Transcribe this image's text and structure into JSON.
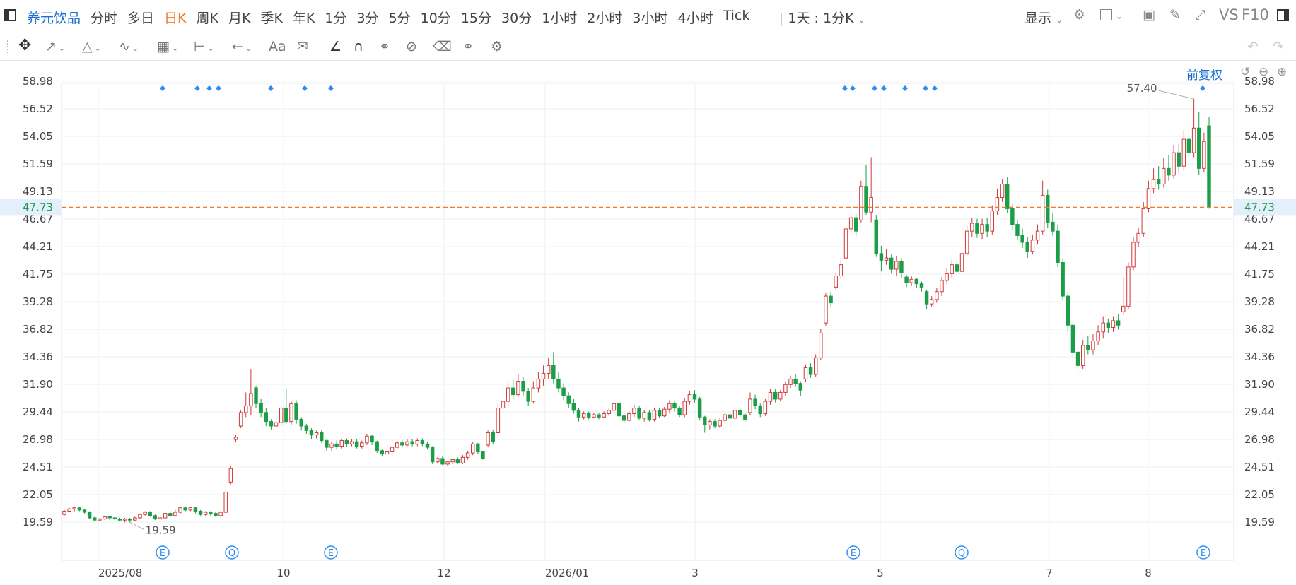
{
  "header": {
    "stock_name": "养元饮品",
    "period_tabs": [
      "分时",
      "多日",
      "日K",
      "周K",
      "月K",
      "季K",
      "年K",
      "1分",
      "3分",
      "5分",
      "10分",
      "15分",
      "30分",
      "1小时",
      "2小时",
      "3小时",
      "4小时",
      "Tick"
    ],
    "active_tab": "日K",
    "interval_select": "1天 : 1分K",
    "display_menu": "显示",
    "vs_label": "VS",
    "f10_label": "F10"
  },
  "toolbar": {
    "tools": [
      "move-icon",
      "line-icon",
      "polyline-icon",
      "wave-icon",
      "fib-icon",
      "measure-icon",
      "arrow-icon",
      "text-tool",
      "comment-icon",
      "angle-icon",
      "magnet-icon",
      "lock-icon",
      "hide-icon",
      "delete-icon",
      "link-icon",
      "settings-icon"
    ],
    "text_tool_label": "Aa"
  },
  "chart_controls": {
    "adjust_label": "前复权"
  },
  "colors": {
    "up": "#d0393b",
    "down": "#1a9e47",
    "marker": "#2d8cf0",
    "price_line": "#f0792b",
    "axis_text": "#444",
    "grid": "#eef0f2"
  },
  "chart_data": {
    "type": "candlestick",
    "y_ticks": [
      "58.98",
      "56.52",
      "54.05",
      "51.59",
      "49.13",
      "46.67",
      "44.21",
      "41.75",
      "39.28",
      "36.82",
      "34.36",
      "31.90",
      "29.44",
      "26.98",
      "24.51",
      "22.05",
      "19.59"
    ],
    "ylim": [
      18.4,
      60.2
    ],
    "x_ticks": [
      "2025/08",
      "10",
      "12",
      "2026/01",
      "3",
      "5",
      "7",
      "8"
    ],
    "current_price": "47.73",
    "current_price_value": 47.73,
    "high_label": "57.40",
    "low_label": "19.59",
    "high_value": 57.4,
    "low_value": 19.59,
    "event_markers": [
      "E",
      "Q",
      "E",
      "E",
      "Q",
      "E"
    ],
    "candles": [
      [
        20.3,
        20.6,
        20.2,
        20.7
      ],
      [
        20.6,
        20.8,
        20.5,
        20.9
      ],
      [
        20.8,
        20.9,
        20.6,
        21.0
      ],
      [
        20.9,
        20.7,
        20.6,
        21.0
      ],
      [
        20.7,
        20.5,
        20.4,
        20.8
      ],
      [
        20.5,
        20.0,
        19.9,
        20.6
      ],
      [
        20.0,
        19.8,
        19.7,
        20.1
      ],
      [
        19.8,
        19.9,
        19.7,
        20.0
      ],
      [
        19.9,
        20.1,
        19.8,
        20.2
      ],
      [
        20.1,
        20.0,
        19.8,
        20.2
      ],
      [
        20.0,
        19.9,
        19.8,
        20.1
      ],
      [
        19.9,
        19.8,
        19.7,
        20.0
      ],
      [
        19.8,
        19.9,
        19.6,
        20.0
      ],
      [
        19.9,
        19.8,
        19.59,
        20.0
      ],
      [
        19.8,
        20.0,
        19.7,
        20.1
      ],
      [
        20.0,
        20.3,
        19.9,
        20.4
      ],
      [
        20.3,
        20.5,
        20.2,
        20.6
      ],
      [
        20.5,
        20.2,
        20.1,
        20.6
      ],
      [
        20.2,
        19.9,
        19.8,
        20.3
      ],
      [
        19.9,
        20.0,
        19.8,
        20.1
      ],
      [
        20.0,
        20.4,
        19.9,
        20.5
      ],
      [
        20.4,
        20.2,
        20.1,
        20.6
      ],
      [
        20.2,
        20.5,
        20.1,
        20.7
      ],
      [
        20.5,
        20.9,
        20.4,
        21.0
      ],
      [
        20.9,
        20.7,
        20.6,
        21.0
      ],
      [
        20.7,
        20.9,
        20.6,
        21.0
      ],
      [
        20.9,
        20.6,
        20.4,
        21.0
      ],
      [
        20.6,
        20.3,
        20.2,
        20.7
      ],
      [
        20.3,
        20.5,
        20.2,
        20.6
      ],
      [
        20.5,
        20.4,
        20.2,
        20.6
      ],
      [
        20.4,
        20.2,
        20.1,
        20.5
      ],
      [
        20.2,
        20.5,
        20.1,
        20.6
      ],
      [
        20.5,
        22.3,
        20.4,
        22.4
      ],
      [
        23.2,
        24.4,
        23.0,
        24.6
      ],
      [
        27.0,
        27.2,
        26.8,
        27.4
      ],
      [
        28.2,
        29.4,
        28.0,
        29.6
      ],
      [
        29.4,
        30.0,
        29.0,
        31.2
      ],
      [
        30.0,
        31.1,
        29.2,
        33.3
      ],
      [
        31.6,
        30.2,
        29.8,
        31.8
      ],
      [
        30.2,
        29.4,
        29.0,
        30.6
      ],
      [
        29.4,
        28.6,
        28.2,
        29.8
      ],
      [
        28.6,
        28.2,
        27.9,
        28.8
      ],
      [
        28.2,
        28.5,
        28.0,
        29.2
      ],
      [
        28.5,
        29.8,
        28.2,
        30.0
      ],
      [
        29.8,
        28.6,
        28.4,
        31.5
      ],
      [
        28.6,
        30.2,
        28.3,
        30.4
      ],
      [
        30.2,
        28.8,
        28.4,
        30.5
      ],
      [
        28.8,
        28.2,
        27.8,
        29.0
      ],
      [
        28.2,
        27.8,
        27.5,
        28.4
      ],
      [
        27.8,
        27.4,
        27.0,
        28.0
      ],
      [
        27.4,
        27.6,
        27.1,
        27.8
      ],
      [
        27.6,
        26.9,
        26.7,
        27.8
      ],
      [
        26.9,
        26.3,
        26.0,
        27.0
      ],
      [
        26.3,
        26.6,
        26.0,
        26.8
      ],
      [
        26.6,
        26.4,
        26.1,
        26.9
      ],
      [
        26.4,
        26.9,
        26.2,
        27.0
      ],
      [
        26.9,
        26.6,
        26.3,
        27.1
      ],
      [
        26.6,
        26.8,
        26.4,
        27.0
      ],
      [
        26.8,
        26.4,
        26.2,
        27.0
      ],
      [
        26.4,
        26.7,
        26.2,
        26.9
      ],
      [
        26.7,
        27.3,
        26.5,
        27.5
      ],
      [
        27.3,
        26.8,
        26.5,
        27.4
      ],
      [
        26.8,
        26.0,
        25.8,
        26.9
      ],
      [
        26.0,
        25.7,
        25.5,
        26.1
      ],
      [
        25.7,
        25.9,
        25.6,
        26.1
      ],
      [
        25.9,
        26.3,
        25.7,
        26.4
      ],
      [
        26.3,
        26.7,
        26.1,
        26.9
      ],
      [
        26.7,
        26.5,
        26.3,
        26.9
      ],
      [
        26.5,
        26.8,
        26.4,
        27.0
      ],
      [
        26.8,
        26.6,
        26.4,
        27.0
      ],
      [
        26.6,
        26.9,
        26.4,
        27.1
      ],
      [
        26.9,
        26.6,
        26.4,
        27.1
      ],
      [
        26.6,
        26.3,
        26.1,
        26.8
      ],
      [
        26.3,
        25.0,
        24.8,
        26.4
      ],
      [
        25.0,
        25.3,
        24.9,
        25.4
      ],
      [
        25.3,
        24.8,
        24.7,
        25.5
      ],
      [
        24.8,
        25.0,
        24.6,
        25.1
      ],
      [
        25.0,
        25.2,
        24.8,
        25.3
      ],
      [
        25.2,
        24.9,
        24.8,
        25.4
      ],
      [
        24.9,
        25.4,
        24.8,
        25.6
      ],
      [
        25.4,
        25.8,
        25.2,
        26.0
      ],
      [
        25.8,
        26.6,
        25.6,
        26.8
      ],
      [
        26.6,
        25.9,
        25.7,
        26.7
      ],
      [
        25.9,
        25.3,
        25.2,
        26.0
      ],
      [
        26.5,
        27.6,
        26.3,
        27.8
      ],
      [
        27.6,
        26.8,
        26.6,
        27.9
      ],
      [
        27.6,
        29.8,
        27.3,
        30.2
      ],
      [
        29.8,
        30.4,
        29.4,
        30.8
      ],
      [
        30.4,
        31.6,
        30.0,
        32.1
      ],
      [
        31.6,
        31.0,
        30.6,
        32.4
      ],
      [
        31.0,
        32.2,
        30.8,
        32.8
      ],
      [
        32.2,
        31.3,
        30.9,
        32.6
      ],
      [
        31.3,
        30.4,
        30.0,
        31.6
      ],
      [
        30.4,
        31.6,
        30.2,
        32.2
      ],
      [
        31.6,
        32.4,
        31.2,
        33.0
      ],
      [
        32.4,
        32.9,
        31.8,
        33.6
      ],
      [
        32.9,
        33.6,
        32.4,
        34.3
      ],
      [
        33.6,
        32.4,
        32.0,
        34.8
      ],
      [
        32.4,
        31.6,
        31.2,
        33.0
      ],
      [
        31.6,
        30.9,
        30.5,
        32.0
      ],
      [
        30.9,
        30.2,
        29.8,
        31.2
      ],
      [
        30.2,
        29.6,
        29.3,
        30.6
      ],
      [
        29.6,
        29.0,
        28.6,
        29.8
      ],
      [
        29.0,
        29.3,
        28.8,
        29.5
      ],
      [
        29.3,
        29.0,
        28.8,
        29.5
      ],
      [
        29.0,
        29.2,
        28.9,
        29.4
      ],
      [
        29.2,
        29.0,
        28.8,
        29.4
      ],
      [
        29.0,
        29.3,
        28.9,
        29.5
      ],
      [
        29.3,
        29.6,
        29.1,
        29.8
      ],
      [
        29.6,
        30.2,
        29.4,
        30.5
      ],
      [
        30.2,
        29.1,
        28.7,
        30.4
      ],
      [
        29.1,
        28.7,
        28.5,
        29.3
      ],
      [
        28.7,
        29.3,
        28.6,
        29.5
      ],
      [
        29.3,
        29.8,
        29.0,
        30.1
      ],
      [
        29.8,
        28.9,
        28.7,
        30.0
      ],
      [
        28.9,
        29.4,
        28.6,
        29.6
      ],
      [
        29.4,
        28.8,
        28.6,
        29.6
      ],
      [
        28.8,
        29.6,
        28.6,
        29.8
      ],
      [
        29.6,
        29.1,
        28.9,
        29.8
      ],
      [
        29.1,
        29.7,
        29.0,
        29.9
      ],
      [
        29.7,
        30.2,
        29.4,
        30.5
      ],
      [
        30.2,
        29.8,
        29.5,
        30.4
      ],
      [
        29.8,
        29.2,
        29.0,
        30.0
      ],
      [
        29.2,
        30.4,
        29.0,
        30.7
      ],
      [
        30.4,
        31.0,
        30.1,
        31.3
      ],
      [
        31.0,
        30.6,
        30.3,
        31.4
      ],
      [
        30.6,
        29.0,
        28.7,
        30.8
      ],
      [
        29.0,
        28.3,
        27.6,
        29.1
      ],
      [
        28.3,
        28.6,
        27.9,
        28.8
      ],
      [
        28.6,
        28.2,
        28.0,
        28.8
      ],
      [
        28.2,
        28.7,
        28.0,
        28.9
      ],
      [
        28.7,
        29.2,
        28.5,
        29.4
      ],
      [
        29.2,
        28.9,
        28.6,
        29.4
      ],
      [
        28.9,
        29.6,
        28.7,
        29.8
      ],
      [
        29.6,
        29.2,
        29.0,
        29.8
      ],
      [
        29.2,
        28.8,
        28.6,
        29.4
      ],
      [
        29.4,
        30.6,
        29.2,
        31.2
      ],
      [
        30.6,
        30.0,
        29.7,
        31.0
      ],
      [
        30.0,
        29.3,
        29.0,
        30.2
      ],
      [
        29.3,
        30.4,
        29.1,
        30.6
      ],
      [
        30.4,
        31.2,
        30.1,
        31.5
      ],
      [
        31.2,
        30.6,
        30.3,
        31.5
      ],
      [
        30.6,
        31.2,
        30.4,
        31.4
      ],
      [
        31.2,
        31.9,
        30.9,
        32.2
      ],
      [
        31.9,
        32.4,
        31.6,
        32.7
      ],
      [
        32.4,
        32.0,
        31.7,
        32.8
      ],
      [
        32.0,
        31.4,
        30.9,
        32.2
      ],
      [
        32.4,
        33.4,
        32.1,
        33.7
      ],
      [
        33.4,
        32.8,
        32.5,
        33.8
      ],
      [
        32.8,
        34.3,
        32.6,
        34.6
      ],
      [
        34.3,
        36.5,
        34.1,
        36.9
      ],
      [
        37.4,
        39.8,
        37.1,
        40.1
      ],
      [
        39.8,
        39.2,
        38.9,
        40.2
      ],
      [
        40.6,
        41.6,
        40.3,
        41.9
      ],
      [
        41.6,
        42.6,
        41.3,
        43.2
      ],
      [
        43.2,
        45.8,
        42.9,
        46.3
      ],
      [
        45.8,
        46.8,
        45.3,
        47.3
      ],
      [
        46.8,
        45.6,
        45.2,
        47.1
      ],
      [
        46.6,
        49.6,
        46.3,
        50.1
      ],
      [
        49.6,
        47.3,
        47.0,
        51.5
      ],
      [
        47.3,
        48.6,
        46.4,
        52.2
      ],
      [
        46.6,
        43.6,
        43.3,
        47.0
      ],
      [
        43.6,
        43.0,
        42.0,
        44.3
      ],
      [
        43.0,
        43.2,
        42.6,
        44.0
      ],
      [
        43.2,
        42.2,
        41.8,
        43.5
      ],
      [
        42.2,
        42.9,
        41.6,
        43.4
      ],
      [
        42.9,
        41.9,
        41.4,
        43.2
      ],
      [
        41.5,
        41.0,
        40.6,
        41.7
      ],
      [
        41.0,
        41.3,
        40.7,
        41.6
      ],
      [
        41.3,
        40.9,
        40.5,
        41.4
      ],
      [
        40.9,
        40.6,
        40.2,
        41.1
      ],
      [
        40.2,
        39.1,
        38.6,
        40.4
      ],
      [
        39.1,
        39.5,
        38.8,
        39.8
      ],
      [
        39.5,
        40.2,
        39.2,
        40.5
      ],
      [
        40.2,
        41.2,
        39.8,
        41.5
      ],
      [
        41.2,
        41.8,
        40.9,
        42.3
      ],
      [
        41.8,
        42.6,
        41.4,
        43.0
      ],
      [
        42.6,
        42.0,
        41.6,
        43.2
      ],
      [
        42.0,
        43.6,
        41.7,
        44.2
      ],
      [
        43.6,
        45.6,
        43.3,
        46.1
      ],
      [
        45.6,
        46.3,
        45.1,
        46.8
      ],
      [
        46.3,
        45.4,
        45.0,
        46.7
      ],
      [
        45.4,
        46.2,
        44.9,
        46.7
      ],
      [
        46.2,
        45.6,
        45.1,
        46.8
      ],
      [
        45.6,
        47.4,
        45.3,
        47.9
      ],
      [
        47.4,
        48.6,
        47.0,
        49.4
      ],
      [
        48.6,
        49.8,
        48.2,
        50.2
      ],
      [
        49.8,
        47.6,
        47.2,
        50.4
      ],
      [
        47.6,
        46.2,
        45.7,
        48.0
      ],
      [
        46.2,
        45.2,
        44.8,
        46.6
      ],
      [
        45.2,
        44.6,
        44.1,
        45.8
      ],
      [
        44.6,
        43.8,
        43.2,
        45.1
      ],
      [
        43.8,
        44.8,
        43.5,
        45.3
      ],
      [
        44.8,
        45.6,
        44.4,
        46.2
      ],
      [
        45.6,
        48.8,
        45.3,
        50.1
      ],
      [
        48.8,
        46.4,
        45.9,
        49.3
      ],
      [
        46.4,
        45.6,
        45.2,
        47.2
      ],
      [
        45.6,
        42.8,
        42.4,
        46.2
      ],
      [
        42.8,
        39.8,
        39.4,
        43.2
      ],
      [
        39.8,
        37.2,
        36.6,
        40.2
      ],
      [
        37.2,
        34.8,
        34.3,
        37.6
      ],
      [
        34.8,
        33.6,
        32.9,
        35.2
      ],
      [
        33.6,
        35.4,
        33.3,
        35.9
      ],
      [
        35.4,
        35.0,
        34.6,
        36.2
      ],
      [
        35.0,
        35.8,
        34.6,
        36.4
      ],
      [
        35.8,
        36.6,
        35.4,
        37.2
      ],
      [
        36.6,
        37.4,
        36.0,
        38.0
      ],
      [
        37.4,
        37.0,
        36.5,
        37.8
      ],
      [
        37.0,
        37.6,
        36.6,
        38.0
      ],
      [
        37.6,
        37.2,
        36.8,
        38.2
      ],
      [
        38.4,
        38.9,
        38.1,
        41.5
      ],
      [
        38.9,
        42.4,
        38.6,
        42.8
      ],
      [
        42.4,
        44.6,
        42.1,
        45.1
      ],
      [
        44.6,
        45.4,
        44.2,
        45.9
      ],
      [
        45.4,
        47.6,
        45.1,
        48.2
      ],
      [
        47.6,
        49.4,
        47.3,
        50.1
      ],
      [
        49.4,
        50.2,
        49.0,
        51.2
      ],
      [
        50.2,
        49.8,
        49.3,
        51.4
      ],
      [
        49.8,
        51.2,
        49.5,
        52.1
      ],
      [
        51.2,
        50.6,
        50.1,
        52.4
      ],
      [
        50.6,
        52.6,
        50.3,
        53.3
      ],
      [
        52.6,
        51.4,
        50.8,
        53.4
      ],
      [
        51.4,
        53.8,
        51.0,
        54.6
      ],
      [
        53.8,
        52.6,
        52.1,
        55.2
      ],
      [
        52.6,
        54.8,
        52.2,
        57.4
      ],
      [
        54.8,
        51.2,
        50.6,
        56.2
      ],
      [
        51.2,
        53.6,
        50.9,
        54.4
      ],
      [
        55.0,
        47.73,
        47.6,
        55.8
      ]
    ]
  }
}
